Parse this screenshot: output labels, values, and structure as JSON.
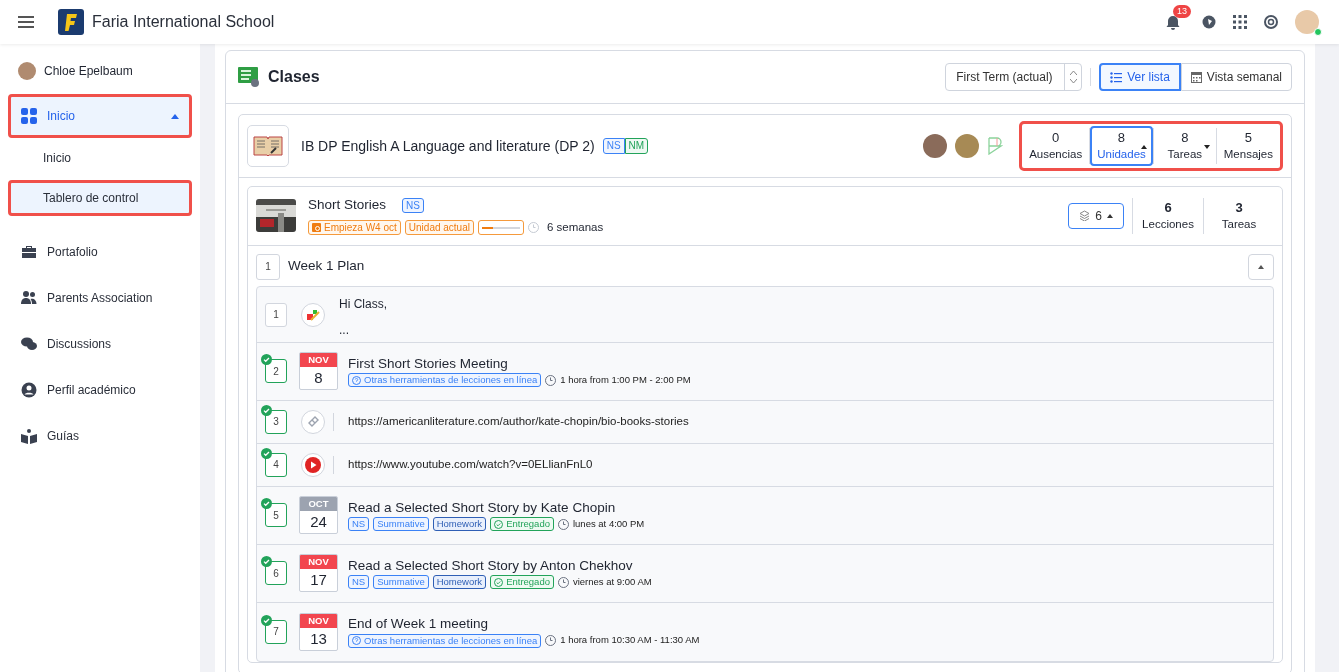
{
  "header": {
    "school_name": "Faria International School",
    "notifications": "13"
  },
  "sidebar": {
    "user_name": "Chloe Epelbaum",
    "items": [
      {
        "label": "Inicio",
        "selected": true,
        "highlighted": true,
        "expanded": true,
        "children": [
          {
            "label": "Inicio",
            "selected": false,
            "highlighted": false
          },
          {
            "label": "Tablero de control",
            "selected": true,
            "highlighted": true
          }
        ]
      },
      {
        "label": "Portafolio",
        "selected": false,
        "highlighted": false
      },
      {
        "label": "Parents Association",
        "selected": false,
        "highlighted": false
      },
      {
        "label": "Discussions",
        "selected": false,
        "highlighted": false
      },
      {
        "label": "Perfil académico",
        "selected": false,
        "highlighted": false
      },
      {
        "label": "Guías",
        "selected": false,
        "highlighted": false
      }
    ]
  },
  "main": {
    "title": "Clases",
    "term": "First Term (actual)",
    "views": [
      {
        "label": "Ver lista",
        "selected": true
      },
      {
        "label": "Vista semanal",
        "selected": false
      }
    ]
  },
  "class": {
    "title": "IB DP English A Language and literature (DP 2)",
    "tags": [
      {
        "label": "NS",
        "color": "#3b82f6"
      },
      {
        "label": "NM",
        "color": "#22a35a"
      }
    ],
    "stats_highlighted": true,
    "stats": [
      {
        "value": "0",
        "label": "Ausencias",
        "selected": false
      },
      {
        "value": "8",
        "label": "Unidades",
        "selected": true,
        "expanded": true
      },
      {
        "value": "8",
        "label": "Tareas",
        "selected": false,
        "expanded": false
      },
      {
        "value": "5",
        "label": "Mensajes",
        "selected": false
      }
    ]
  },
  "unit": {
    "title": "Short Stories",
    "tag": "NS",
    "badges": [
      {
        "label": "Empieza W4 oct",
        "kind": "date"
      },
      {
        "label": "Unidad actual",
        "kind": "plain"
      }
    ],
    "progress": {
      "level": 0.3
    },
    "duration": "6 semanas",
    "layers_count": "6",
    "stats": [
      {
        "value": "6",
        "label": "Lecciones"
      },
      {
        "value": "3",
        "label": "Tareas"
      }
    ]
  },
  "section": {
    "number": "1",
    "title": "Week 1 Plan",
    "expanded": true
  },
  "items": [
    {
      "kind": "note",
      "number": "1",
      "done": false,
      "lines": [
        "Hi Class,",
        "..."
      ]
    },
    {
      "kind": "event",
      "number": "2",
      "done": true,
      "month": "NOV",
      "day": "8",
      "color": "#f2464f",
      "title": "First Short Stories Meeting",
      "tags": [
        {
          "label": "Otras herramientas de lecciones en línea",
          "kind": "tool"
        }
      ],
      "time": "1 hora from 1:00 PM - 2:00 PM"
    },
    {
      "kind": "link",
      "number": "3",
      "done": true,
      "url": "https://americanliterature.com/author/kate-chopin/bio-books-stories"
    },
    {
      "kind": "video",
      "number": "4",
      "done": true,
      "url": "https://www.youtube.com/watch?v=0ELlianFnL0"
    },
    {
      "kind": "event",
      "number": "5",
      "done": true,
      "month": "OCT",
      "day": "24",
      "color": "#9ca3b0",
      "title": "Read a Selected Short Story by Kate Chopin",
      "tags": [
        {
          "label": "NS",
          "kind": "level"
        },
        {
          "label": "Summative",
          "kind": "level"
        },
        {
          "label": "Homework",
          "kind": "type"
        },
        {
          "label": "Entregado",
          "kind": "status"
        }
      ],
      "time": "lunes at 4:00 PM"
    },
    {
      "kind": "event",
      "number": "6",
      "done": true,
      "month": "NOV",
      "day": "17",
      "color": "#f2464f",
      "title": "Read a Selected Short Story by Anton Chekhov",
      "tags": [
        {
          "label": "NS",
          "kind": "level"
        },
        {
          "label": "Summative",
          "kind": "level"
        },
        {
          "label": "Homework",
          "kind": "type"
        },
        {
          "label": "Entregado",
          "kind": "status"
        }
      ],
      "time": "viernes at 9:00 AM"
    },
    {
      "kind": "event",
      "number": "7",
      "done": true,
      "month": "NOV",
      "day": "13",
      "color": "#f2464f",
      "title": "End of Week 1 meeting",
      "tags": [
        {
          "label": "Otras herramientas de lecciones en línea",
          "kind": "tool"
        }
      ],
      "time": "1 hora from 10:30 AM - 11:30 AM"
    }
  ]
}
